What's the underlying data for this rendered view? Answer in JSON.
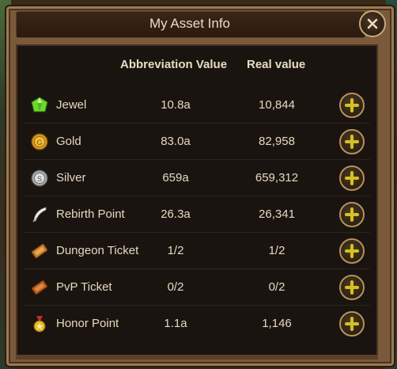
{
  "dialog": {
    "title": "My Asset Info",
    "close_icon": "close-x-icon"
  },
  "columns": {
    "abbreviation": "Abbreviation Value",
    "real": "Real value"
  },
  "assets": [
    {
      "name": "Jewel",
      "abbr": "10.8a",
      "real": "10,844",
      "icon": "green-gem-icon"
    },
    {
      "name": "Gold",
      "abbr": "83.0a",
      "real": "82,958",
      "icon": "gold-coin-icon"
    },
    {
      "name": "Silver",
      "abbr": "659a",
      "real": "659,312",
      "icon": "silver-coin-icon"
    },
    {
      "name": "Rebirth Point",
      "abbr": "26.3a",
      "real": "26,341",
      "icon": "white-feather-icon"
    },
    {
      "name": "Dungeon Ticket",
      "abbr": "1/2",
      "real": "1/2",
      "icon": "dungeon-ticket-icon"
    },
    {
      "name": "PvP Ticket",
      "abbr": "0/2",
      "real": "0/2",
      "icon": "pvp-ticket-icon"
    },
    {
      "name": "Honor Point",
      "abbr": "1.1a",
      "real": "1,146",
      "icon": "honor-medal-icon"
    }
  ],
  "colors": {
    "accent_plus": "#d8c020",
    "text": "#e6d8c0",
    "frame": "#7a5a3a",
    "panel": "#1a1410"
  }
}
